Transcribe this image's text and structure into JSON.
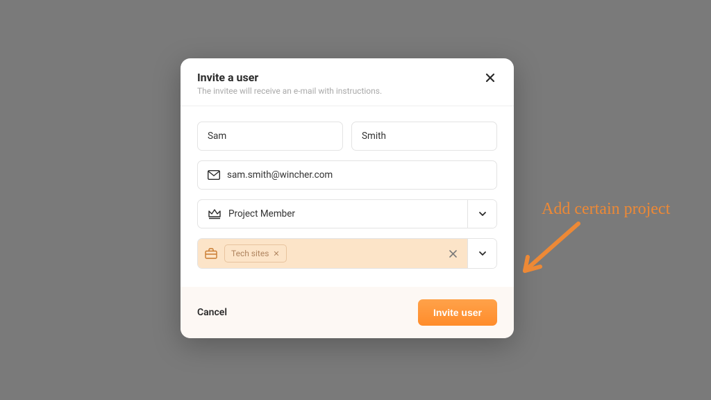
{
  "modal": {
    "title": "Invite a user",
    "subtitle": "The invitee will receive an e-mail with instructions.",
    "first_name": "Sam",
    "last_name": "Smith",
    "email": "sam.smith@wincher.com",
    "role": "Project Member",
    "project_chip": "Tech sites",
    "cancel_label": "Cancel",
    "invite_label": "Invite user"
  },
  "annotation": {
    "text": "Add certain project"
  }
}
